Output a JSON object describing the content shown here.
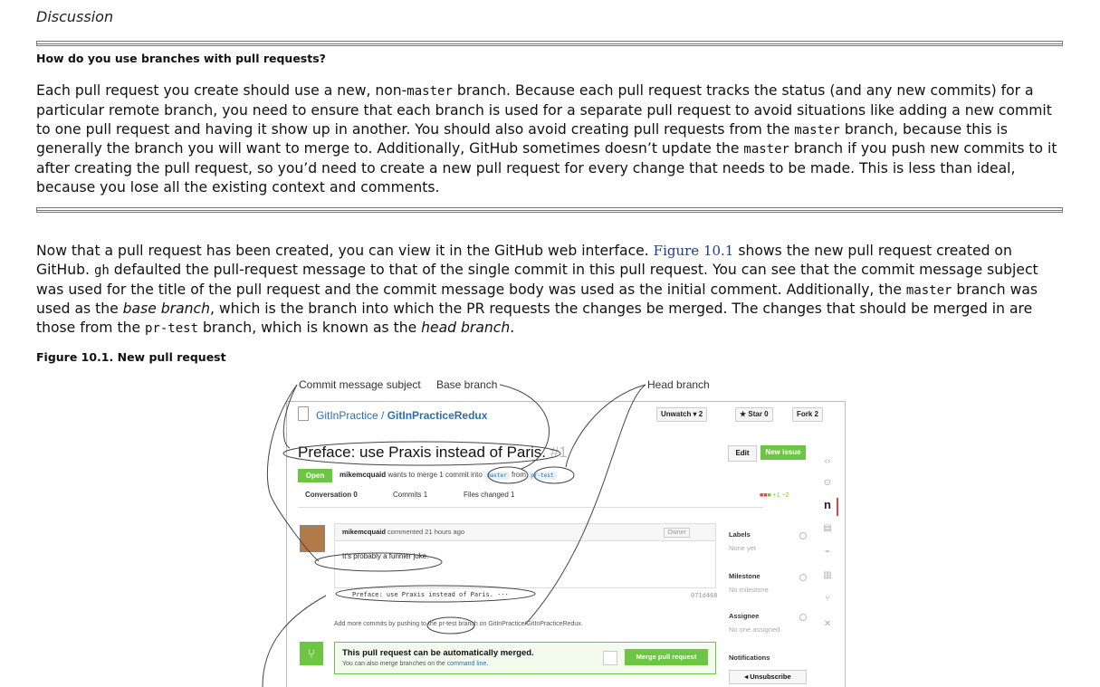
{
  "section": {
    "title": "Discussion"
  },
  "sidebar": {
    "heading": "How do you use branches with pull requests?",
    "p1_a": "Each pull request you create should use a new, non-",
    "code_master": "master",
    "p1_b": " branch. Because each pull request tracks the status (and any new commits) for a particular remote branch, you need to ensure that each branch is used for a separate pull request to avoid situations like adding a new commit to one pull request and having it show up in another. You should also avoid creating pull requests from the ",
    "p1_c": " branch, because this is generally the branch you will want to merge to. Additionally, GitHub sometimes doesn’t update the ",
    "p1_d": " branch if you push new commits to it after creating the pull request, so you’d need to create a new pull request for every change that needs to be made. This is less than ideal, because you lose all the existing context and comments."
  },
  "body": {
    "p2_a": "Now that a pull request has been created, you can view it in the GitHub web interface. ",
    "figure_ref": "Figure 10.1",
    "p2_b": " shows the new pull request created on GitHub. ",
    "code_gh": "gh",
    "p2_c": " defaulted the pull-request message to that of the single commit in this pull request. You can see that the commit message subject was used for the title of the pull request and the commit message body was used as the initial comment. Additionally, the ",
    "code_master": "master",
    "p2_d": " branch was used as the ",
    "em_base": "base branch",
    "p2_e": ", which is the branch into which the PR requests the changes be merged. The changes that should be merged in are those from the ",
    "code_prtest": "pr-test",
    "p2_f": " branch, which is known as the ",
    "em_head": "head branch",
    "p2_g": "."
  },
  "figure": {
    "caption": "Figure 10.1. New pull request",
    "annotations": {
      "commit_subject": "Commit message subject",
      "base_branch": "Base branch",
      "head_branch": "Head branch"
    },
    "repo_owner": "GitInPractice",
    "repo_sep": " / ",
    "repo_name": "GitInPracticeRedux",
    "unwatch": "Unwatch ▾  2",
    "star": "★ Star  0",
    "fork": "Fork  2",
    "pr_title": "Preface: use Praxis instead of Paris.",
    "pr_number": "#1",
    "edit": "Edit",
    "new_issue": "New issue",
    "open": "Open",
    "author": "mikemcquaid",
    "meta_text": " wants to merge 1 commit into ",
    "base": "master",
    "from": " from ",
    "head": "pr-test",
    "tab_conversation": "Conversation  0",
    "tab_commits": "Commits  1",
    "tab_files": "Files changed  1",
    "diffstat": "+1 −2",
    "comment_author": "mikemcquaid",
    "comment_time": " commented 21 hours ago",
    "owner": "Owner",
    "comment_body": "It's probably a funnier joke.",
    "commit_line": "Preface: use Praxis instead of Paris. ···",
    "commit_sha": "071d468",
    "add_more": "Add more commits by pushing to the pr-test branch on GitInPractice/GitInPracticeRedux.",
    "merge_title": "This pull request can be automatically merged.",
    "merge_sub": "You can also merge branches on the ",
    "merge_link": "command line.",
    "merge_button": "Merge pull request",
    "labels": "Labels",
    "labels_val": "None yet",
    "milestone": "Milestone",
    "milestone_val": "No milestone",
    "assignee": "Assignee",
    "assignee_val": "No one assigned",
    "notifications": "Notifications",
    "unsubscribe": "Unsubscribe"
  }
}
